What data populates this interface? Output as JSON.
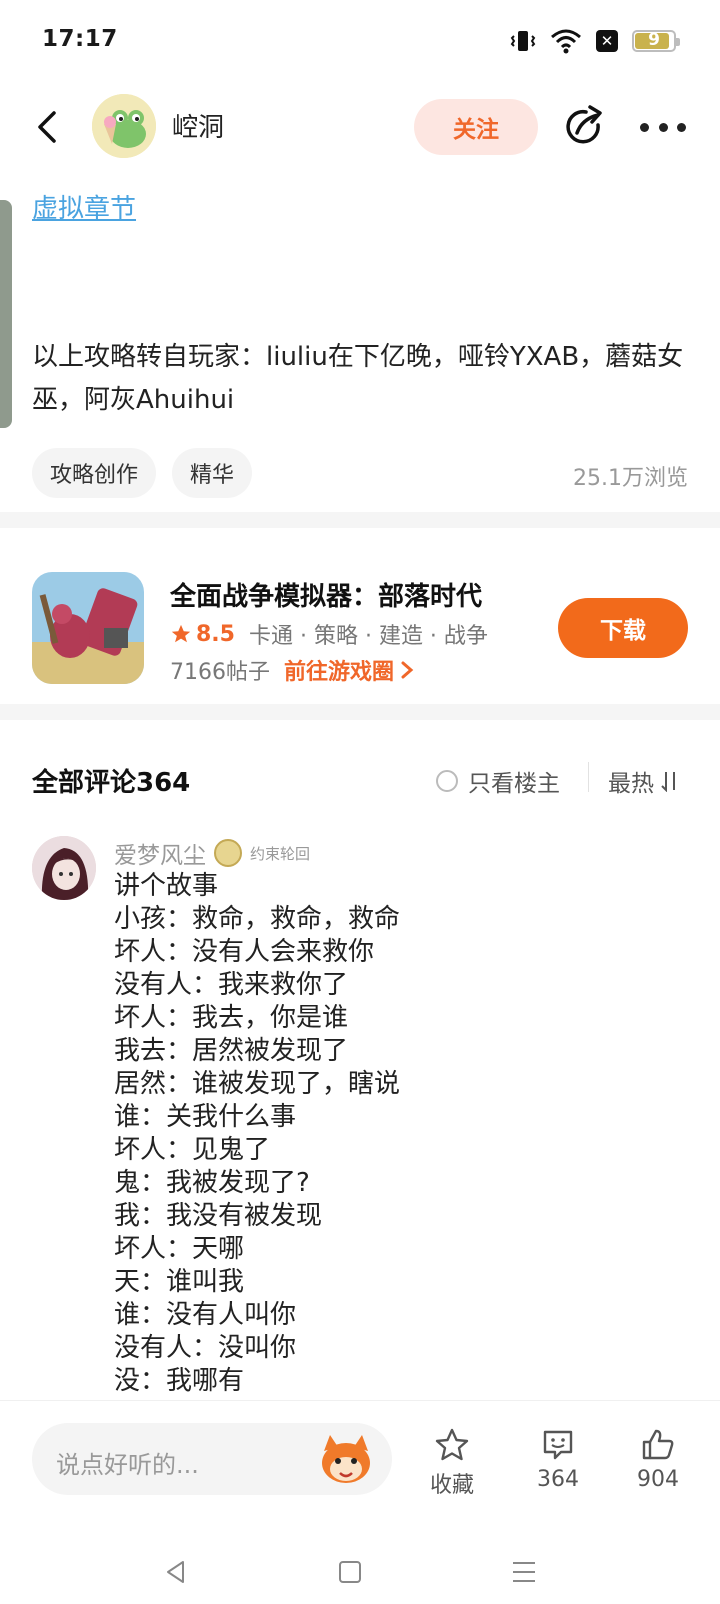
{
  "status_bar": {
    "time": "17:17",
    "battery": "9"
  },
  "header": {
    "author": "崆洞",
    "follow_label": "关注"
  },
  "article": {
    "chapter_link": "虚拟章节",
    "credit_text": "以上攻略转自玩家：liuliu在下亿晚，哑铃YXAB，蘑菇女巫，阿灰Ahuihui",
    "tags": [
      "攻略创作",
      "精华"
    ],
    "views": "25.1万浏览"
  },
  "game": {
    "title": "全面战争模拟器：部落时代",
    "rating": "8.5",
    "genres": "卡通 · 策略 · 建造 · 战争",
    "posts": "7166帖子",
    "goto_label": "前往游戏圈",
    "download_label": "下载"
  },
  "comments": {
    "title": "全部评论364",
    "only_op_label": "只看楼主",
    "sort_label": "最热"
  },
  "comment": {
    "author": "爱梦风尘",
    "badge": "约束轮回",
    "lines": [
      "讲个故事",
      "小孩：救命，救命，救命",
      "坏人：没有人会来救你",
      "没有人：我来救你了",
      "坏人：我去，你是谁",
      "我去：居然被发现了",
      "居然：谁被发现了，瞎说",
      "谁：关我什么事",
      "坏人：见鬼了",
      "鬼：我被发现了?",
      "我：我没有被发现",
      "坏人：天哪",
      "天：谁叫我",
      "谁：没有人叫你",
      "没有人：没叫你",
      "没：我哪有"
    ]
  },
  "bottom_bar": {
    "input_placeholder": "说点好听的...",
    "favorite_label": "收藏",
    "comment_count": "364",
    "like_count": "904"
  },
  "colors": {
    "accent": "#f26a1b",
    "link": "#4aa3e0",
    "follow_bg": "#fde6e1"
  }
}
